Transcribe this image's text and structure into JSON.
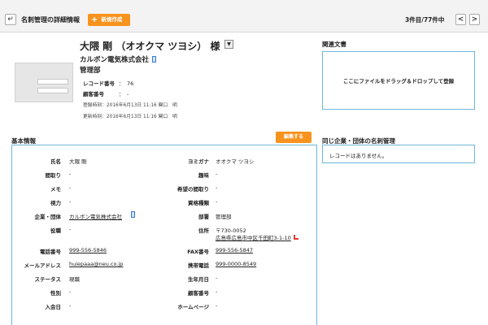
{
  "topbar": {
    "back_icon": "↵",
    "title": "名刺管理の詳細情報",
    "new_button": "新規作成",
    "counter": "3件目/77件中",
    "prev": "<",
    "next": ">"
  },
  "header": {
    "name": "大隈 剛 （オオクマ ツヨシ） 様",
    "dropdown": "▼",
    "company": "カルボン電気株式会社",
    "department": "管理部",
    "record_label": "レコード番号",
    "record_sep": "：",
    "record_value": "76",
    "customer_label": "顧客番号",
    "customer_sep": "：",
    "customer_value": "-",
    "registered": "登録時刻：2016年6月13日 11:16  関口　明",
    "updated": "更新時刻：2016年6月13日 11:16  関口　明"
  },
  "related": {
    "title": "関連文書",
    "dropzone": "ここにファイルをドラッグ＆ドロップして登録"
  },
  "basic": {
    "title": "基本情報",
    "edit_button": "編集する",
    "left": [
      {
        "label": "氏名",
        "value": "大隈 剛"
      },
      {
        "label": "間取り",
        "value": "-"
      },
      {
        "label": "メモ",
        "value": "-"
      },
      {
        "label": "視力",
        "value": "-"
      },
      {
        "label": "企業・団体",
        "value": "カルボン電気株式会社"
      },
      {
        "label": "役職",
        "value": "-"
      },
      {
        "label": "電話番号",
        "value": "999-556-5846"
      },
      {
        "label": "メールアドレス",
        "value": "huiepaaa@neu.co.jp"
      },
      {
        "label": "ステータス",
        "value": "現職"
      },
      {
        "label": "性別",
        "value": "-"
      },
      {
        "label": "入会日",
        "value": "-"
      }
    ],
    "right": [
      {
        "label": "ヨミガナ",
        "value": "オオクマ ツヨシ"
      },
      {
        "label": "趣味",
        "value": "-"
      },
      {
        "label": "希望の間取り",
        "value": "-"
      },
      {
        "label": "資格種類",
        "value": "-"
      },
      {
        "label": "部署",
        "value": "管理部"
      },
      {
        "label": "住所",
        "value": "〒730-0052"
      },
      {
        "label": "FAX番号",
        "value": "999-556-5847"
      },
      {
        "label": "携帯電話",
        "value": "999-0000-8549"
      },
      {
        "label": "生年月日",
        "value": "-"
      },
      {
        "label": "顧客番号",
        "value": "-"
      },
      {
        "label": "ホームページ",
        "value": "-"
      }
    ],
    "address_line2": "広島県広島市中区千田町3-1-10"
  },
  "same_company": {
    "title": "同じ企業・団体の名刺管理",
    "empty": "レコードはありません。"
  },
  "colors": {
    "accent": "#f7931e",
    "panel_border": "#6fb6dc"
  }
}
